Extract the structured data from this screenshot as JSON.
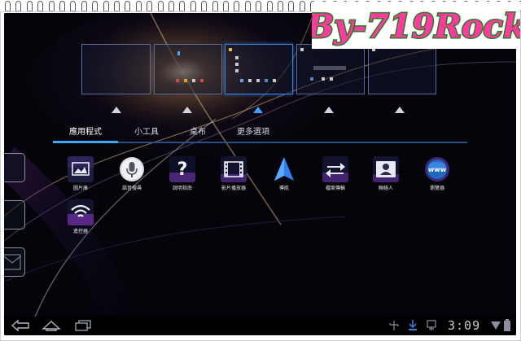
{
  "watermark": {
    "text": "By-719Rock"
  },
  "tabs": [
    {
      "label": "應用程式",
      "active": true
    },
    {
      "label": "小工具",
      "active": false
    },
    {
      "label": "桌布",
      "active": false
    },
    {
      "label": "更多選項",
      "active": false
    }
  ],
  "apps": [
    {
      "label": "圖片庫",
      "icon": "gallery-icon"
    },
    {
      "label": "語音搜尋",
      "icon": "voice-search-icon"
    },
    {
      "label": "說明指南",
      "icon": "help-icon"
    },
    {
      "label": "影片播放器",
      "icon": "video-player-icon"
    },
    {
      "label": "導航",
      "icon": "navigation-icon"
    },
    {
      "label": "檔案傳輸",
      "icon": "file-transfer-icon"
    },
    {
      "label": "聯絡人",
      "icon": "contacts-icon"
    },
    {
      "label": "瀏覽器",
      "icon": "browser-icon"
    },
    {
      "label": "遙控器",
      "icon": "remote-icon"
    }
  ],
  "status_bar": {
    "time": "3:09"
  },
  "colors": {
    "accent": "#44a6ff",
    "background": "#030308",
    "tab_line": "#2a4f86"
  }
}
